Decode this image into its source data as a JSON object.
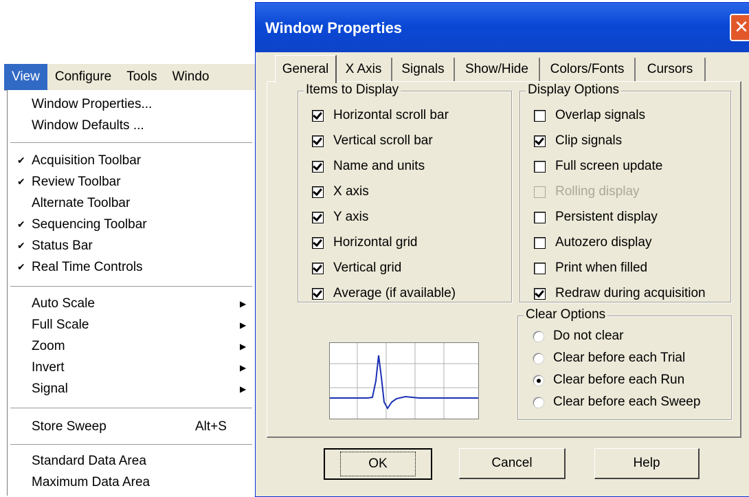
{
  "menubar": {
    "items": [
      {
        "label": "View",
        "u": "V",
        "active": true
      },
      {
        "label": "Configure",
        "u": "C"
      },
      {
        "label": "Tools",
        "u": "T"
      },
      {
        "label": "Windo",
        "u": ""
      }
    ]
  },
  "view_menu": {
    "items": [
      {
        "label": "Window Properties...",
        "checked": false
      },
      {
        "label": "Window Defaults ...",
        "checked": false
      },
      {
        "sep": true
      },
      {
        "label": "Acquisition Toolbar",
        "checked": true
      },
      {
        "label": "Review Toolbar",
        "checked": true
      },
      {
        "label": "Alternate Toolbar",
        "checked": false
      },
      {
        "label": "Sequencing Toolbar",
        "checked": true
      },
      {
        "label": "Status Bar",
        "checked": true
      },
      {
        "label": "Real Time Controls",
        "checked": true
      },
      {
        "sep": true
      },
      {
        "label": "Auto Scale",
        "submenu": true
      },
      {
        "label": "Full Scale",
        "submenu": true
      },
      {
        "label": "Zoom",
        "submenu": true
      },
      {
        "label": "Invert",
        "submenu": true
      },
      {
        "label": "Signal",
        "submenu": true
      },
      {
        "sep": true
      },
      {
        "label": "Store Sweep",
        "shortcut": "Alt+S"
      },
      {
        "sep": true
      },
      {
        "label": "Standard Data Area"
      },
      {
        "label": "Maximum Data Area"
      }
    ]
  },
  "dialog": {
    "title": "Window Properties",
    "close_glyph": "✕",
    "tabs": [
      "General",
      "X Axis",
      "Signals",
      "Show/Hide",
      "Colors/Fonts",
      "Cursors"
    ],
    "active_tab": "General",
    "items_to_display": {
      "legend": "Items to Display",
      "options": [
        {
          "label": "Horizontal scroll bar",
          "checked": true
        },
        {
          "label": "Vertical scroll bar",
          "checked": true
        },
        {
          "label": "Name and units",
          "checked": true
        },
        {
          "label": "X axis",
          "checked": true
        },
        {
          "label": "Y axis",
          "checked": true
        },
        {
          "label": "Horizontal grid",
          "checked": true
        },
        {
          "label": "Vertical grid",
          "checked": true
        },
        {
          "label": "Average (if available)",
          "checked": true
        }
      ]
    },
    "display_options": {
      "legend": "Display Options",
      "options": [
        {
          "label": "Overlap signals",
          "checked": false
        },
        {
          "label": "Clip signals",
          "checked": true
        },
        {
          "label": "Full screen update",
          "checked": false
        },
        {
          "label": "Rolling display",
          "checked": false,
          "disabled": true
        },
        {
          "label": "Persistent display",
          "checked": false
        },
        {
          "label": "Autozero display",
          "checked": false
        },
        {
          "label": "Print when filled",
          "checked": false
        },
        {
          "label": "Redraw during acquisition",
          "checked": true
        }
      ]
    },
    "clear_options": {
      "legend": "Clear Options",
      "options": [
        {
          "label": "Do not clear",
          "selected": false
        },
        {
          "label": "Clear before each Trial",
          "selected": false
        },
        {
          "label": "Clear before each Run",
          "selected": true
        },
        {
          "label": "Clear before each Sweep",
          "selected": false
        }
      ]
    },
    "preview_color": "#1a2fb4",
    "buttons": {
      "ok": "OK",
      "cancel": "Cancel",
      "help": "Help"
    }
  }
}
